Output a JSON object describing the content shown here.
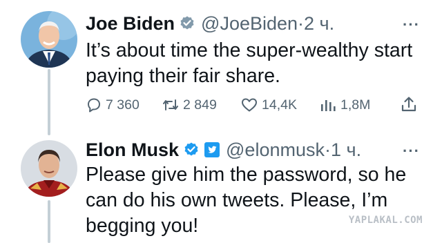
{
  "tweets": [
    {
      "name": "Joe Biden",
      "handle": "@JoeBiden",
      "separator": "·",
      "time": "2 ч.",
      "more": "···",
      "badge": "verified-gray-badge-icon",
      "lines": [
        "It’s about time the super-wealthy start",
        "paying their fair share."
      ],
      "stats": {
        "replies": "7 360",
        "reposts": "2 849",
        "likes": "14,4K",
        "views": "1,8M"
      }
    },
    {
      "name": "Elon Musk",
      "handle": "@elonmusk",
      "separator": "·",
      "time": "1 ч.",
      "more": "···",
      "badge": "verified-blue-badge-icon",
      "lines": [
        "Please give him the password, so he",
        "can do his own tweets. Please, I’m",
        "begging you!"
      ]
    }
  ],
  "watermark": "YAPLAKAL.COM",
  "colors": {
    "text": "#0f1419",
    "secondary": "#536471",
    "thread_line": "#c4cfd6",
    "verified_blue": "#1d9bf0",
    "verified_gray": "#829aab"
  }
}
